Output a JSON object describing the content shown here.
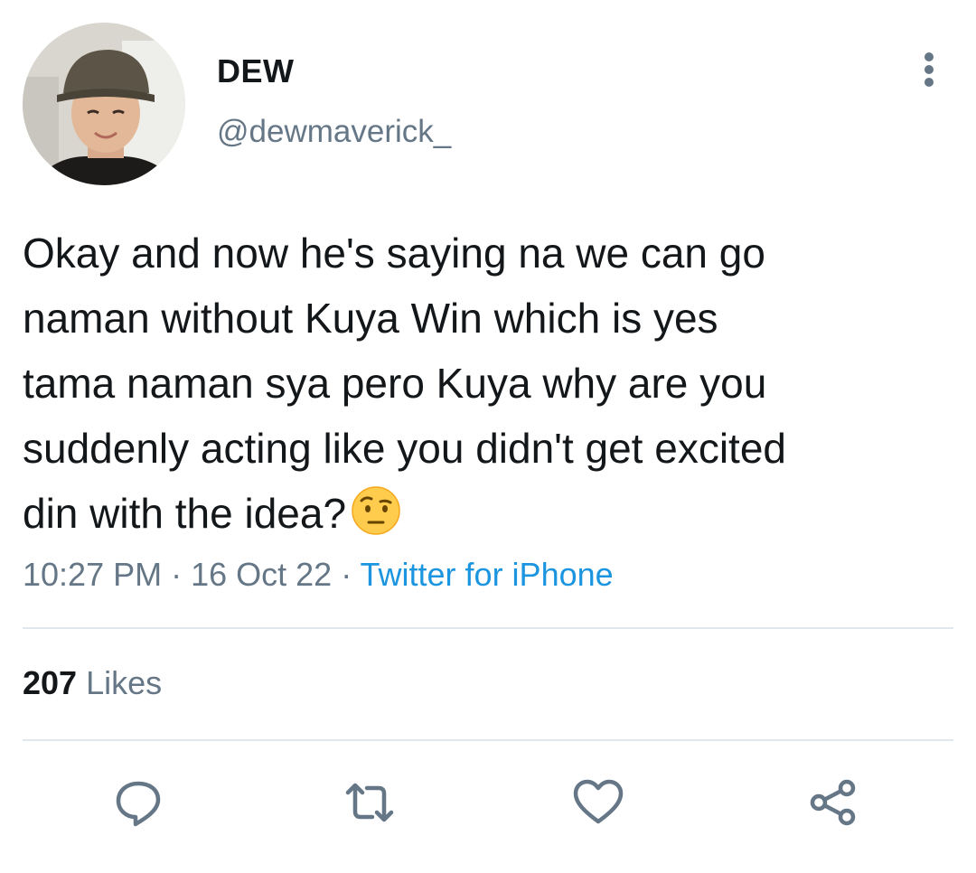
{
  "author": {
    "display_name": "DEW",
    "handle": "@dewmaverick_"
  },
  "tweet": {
    "text": "Okay and now he's saying na we can go\nnaman without Kuya Win which is yes\ntama naman sya pero Kuya why are you\nsuddenly acting like you didn't get excited\ndin with the idea?",
    "emoji": "face-with-raised-eyebrow"
  },
  "meta": {
    "time": "10:27 PM",
    "separator": " · ",
    "date": "16 Oct 22",
    "source": "Twitter for iPhone"
  },
  "stats": {
    "likes_count": "207",
    "likes_label": "Likes"
  },
  "actions": [
    "reply-icon",
    "retweet-icon",
    "like-icon",
    "share-icon"
  ],
  "colors": {
    "text_primary": "#14171a",
    "text_secondary": "#657786",
    "link": "#1b95e0",
    "divider": "#e1e8ed"
  }
}
